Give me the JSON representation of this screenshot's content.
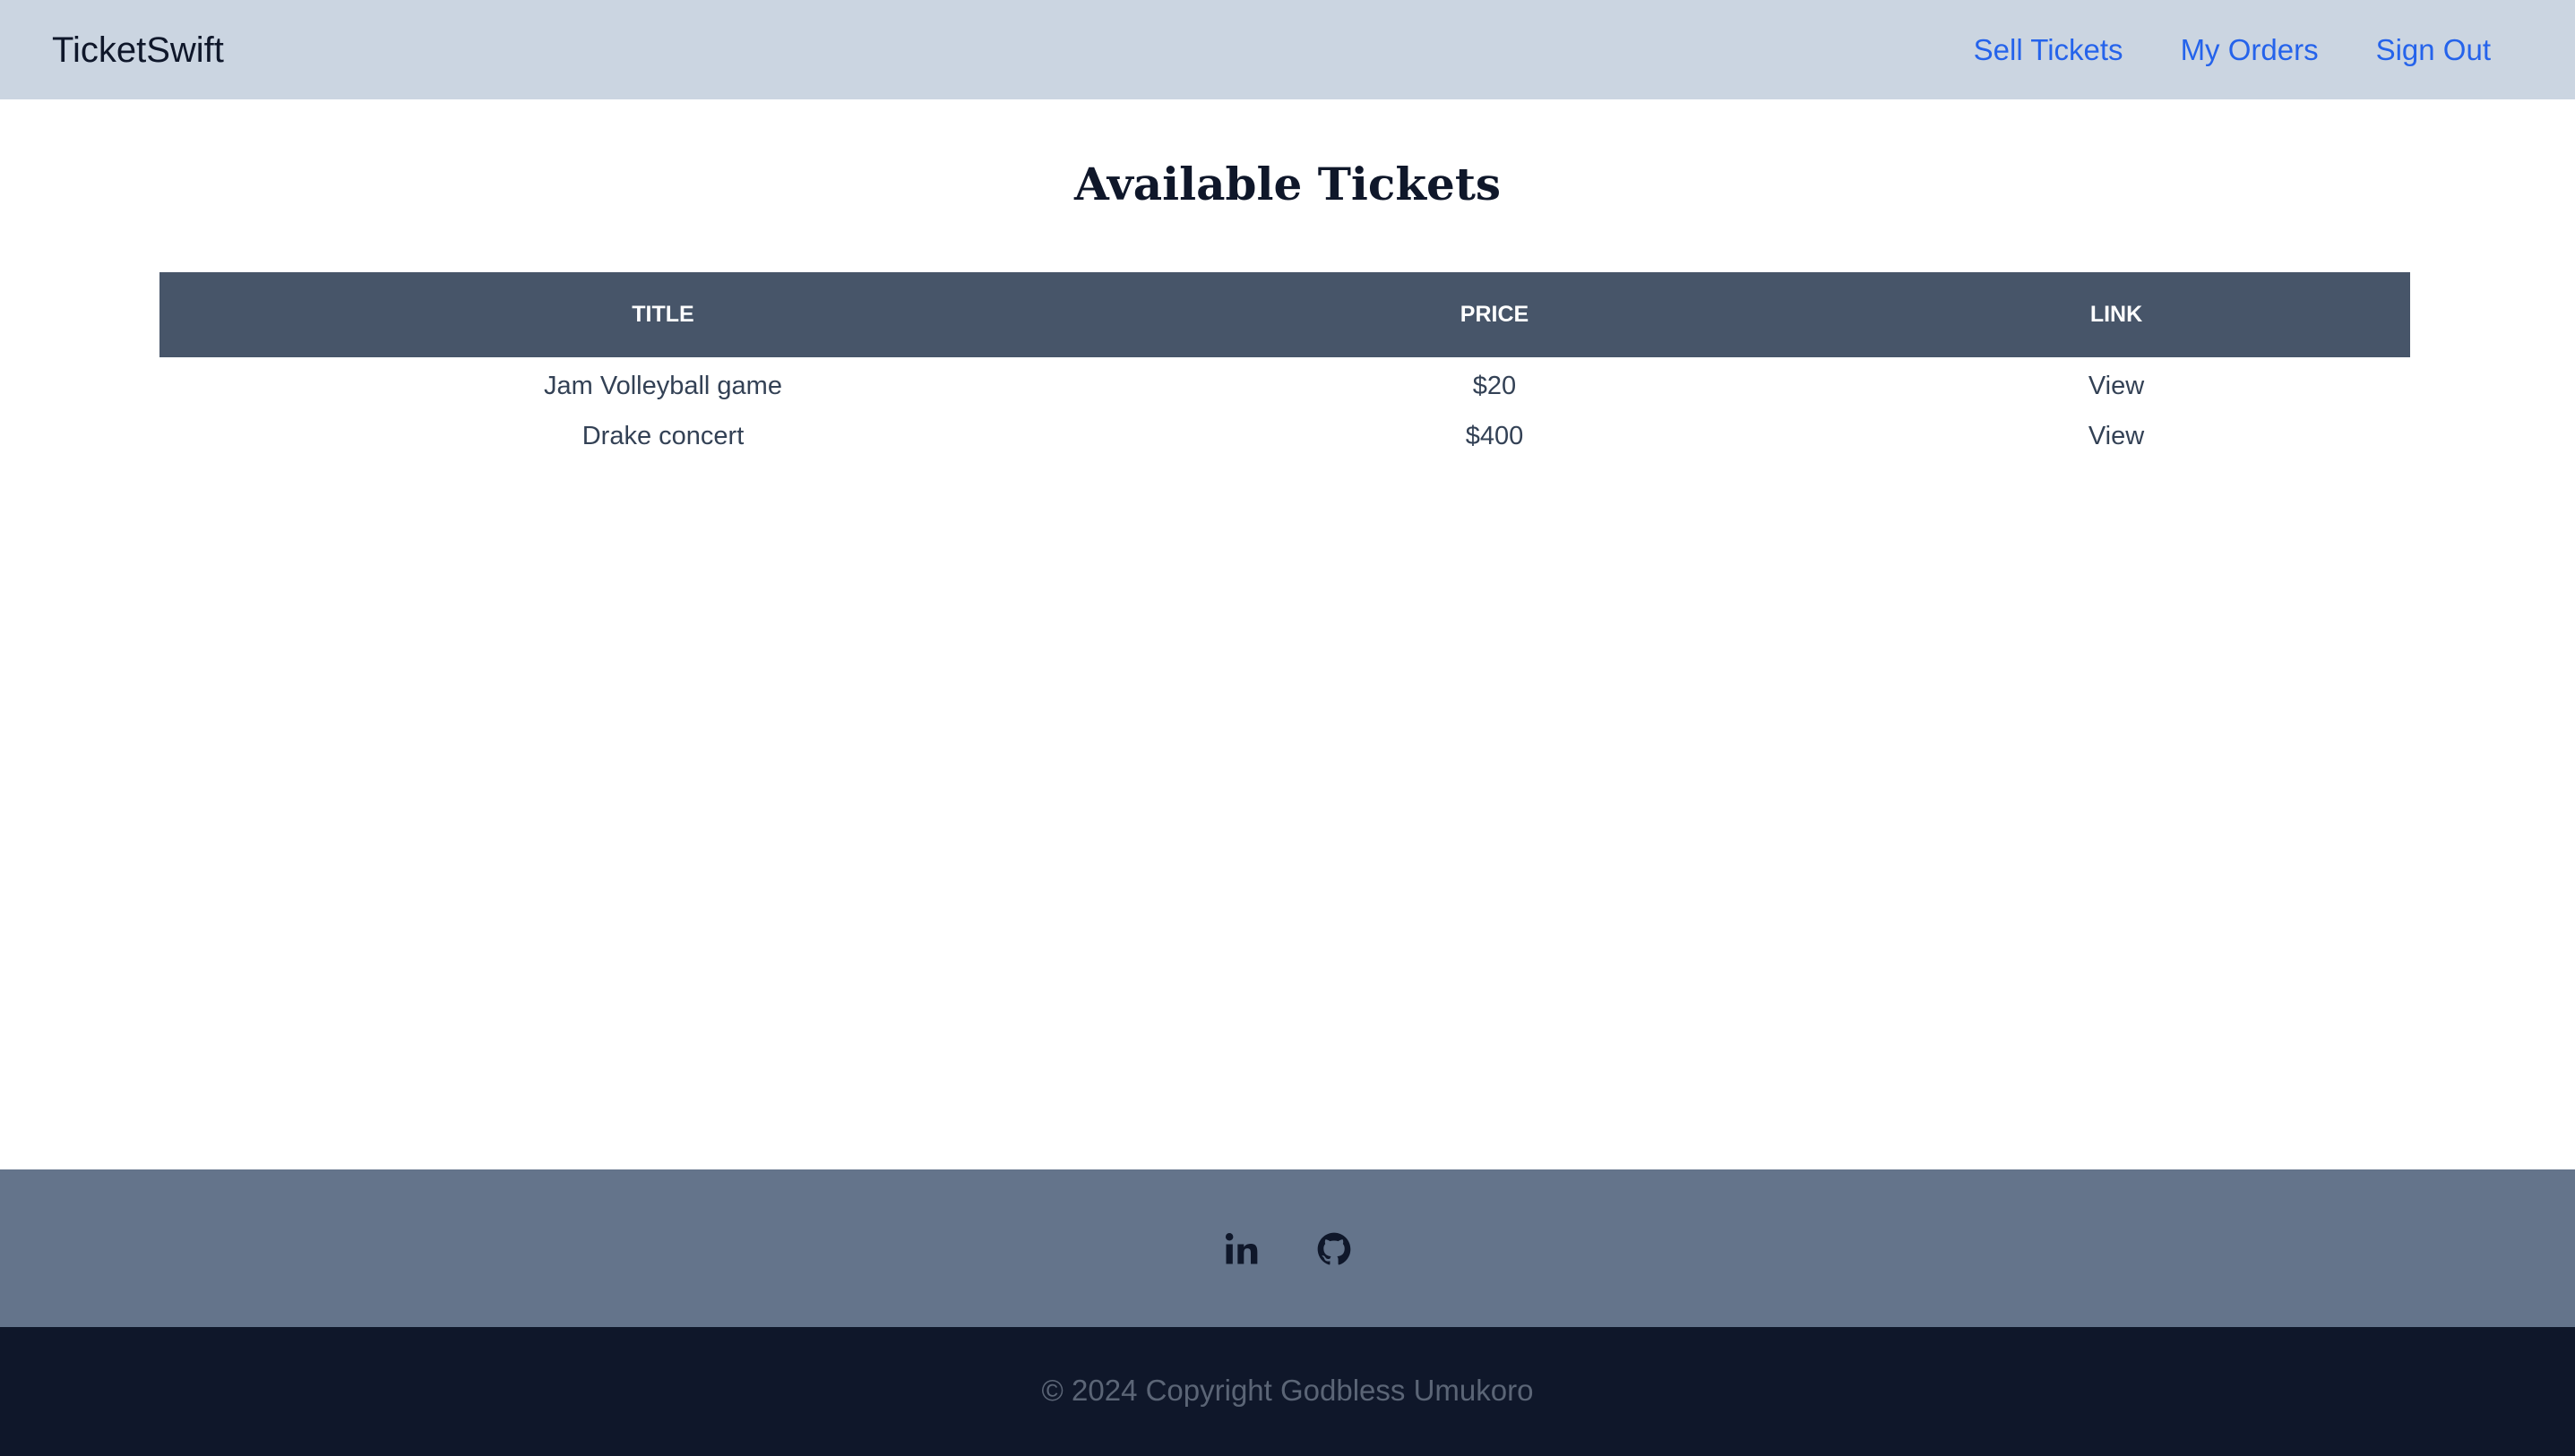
{
  "navbar": {
    "brand": "TicketSwift",
    "links": [
      {
        "label": "Sell Tickets"
      },
      {
        "label": "My Orders"
      },
      {
        "label": "Sign Out"
      }
    ]
  },
  "page": {
    "title": "Available Tickets"
  },
  "table": {
    "headers": [
      "Title",
      "Price",
      "Link"
    ],
    "rows": [
      {
        "title": "Jam Volleyball game",
        "price": "$20",
        "link": "View"
      },
      {
        "title": "Drake concert",
        "price": "$400",
        "link": "View"
      }
    ]
  },
  "footer": {
    "icons": [
      "linkedin-icon",
      "github-icon"
    ],
    "copyright": "© 2024 Copyright Godbless Umukoro"
  },
  "colors": {
    "navbar_bg": "#cbd5e1",
    "nav_link": "#2563eb",
    "table_header_bg": "#475569",
    "social_bar_bg": "#64748b",
    "copyright_bar_bg": "#0f172a"
  }
}
